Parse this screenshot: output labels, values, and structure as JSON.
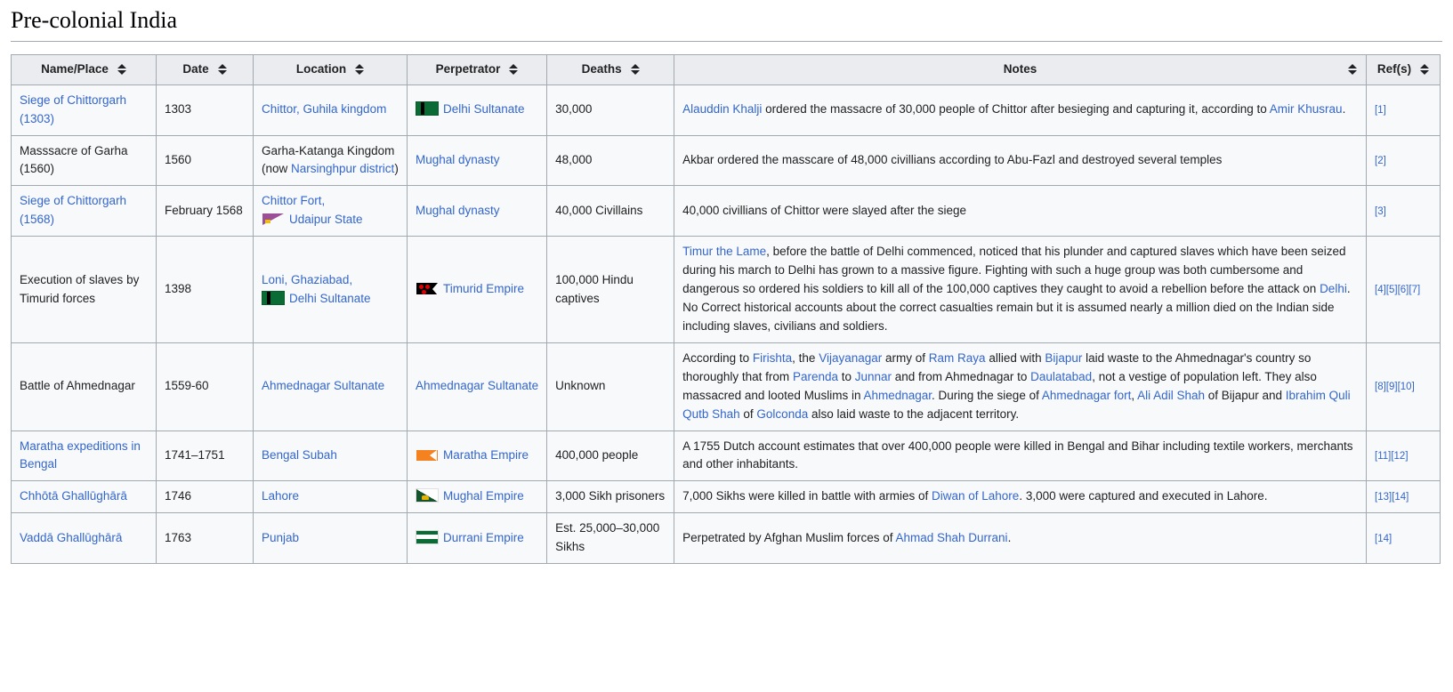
{
  "page": {
    "section_title": "Pre-colonial India"
  },
  "table": {
    "columns": [
      {
        "label": "Name/Place",
        "sortable": true
      },
      {
        "label": "Date",
        "sortable": true
      },
      {
        "label": "Location",
        "sortable": true
      },
      {
        "label": "Perpetrator",
        "sortable": true
      },
      {
        "label": "Deaths",
        "sortable": true
      },
      {
        "label": "Notes",
        "sortable": true
      },
      {
        "label": "Ref(s)",
        "sortable": true
      }
    ],
    "sort_icon": "sort-arrows-icon",
    "rows": [
      {
        "name": {
          "text": "Siege of Chittorgarh (1303)",
          "link": true
        },
        "date": {
          "text": "1303",
          "link": false
        },
        "location": {
          "prefix": "",
          "flag": null,
          "text": "Chittor, Guhila kingdom",
          "link": true
        },
        "perpetrator": {
          "flag": "delhi-sultanate-flag",
          "text": "Delhi Sultanate",
          "link": true
        },
        "deaths": "30,000",
        "notes": [
          {
            "t": "Alauddin Khalji",
            "link": true
          },
          {
            "t": " ordered the massacre of 30,000 people of Chittor after besieging and capturing it, according to ",
            "link": false
          },
          {
            "t": "Amir Khusrau",
            "link": true
          },
          {
            "t": ".",
            "link": false
          }
        ],
        "refs": [
          "[1]"
        ]
      },
      {
        "name": {
          "text": "Masssacre of Garha (1560)",
          "link": false
        },
        "date": {
          "text": "1560",
          "link": false
        },
        "location_parts": [
          {
            "t": "Garha-Katanga Kingdom (now ",
            "link": false
          },
          {
            "t": "Narsinghpur district",
            "link": true
          },
          {
            "t": ")",
            "link": false
          }
        ],
        "perpetrator": {
          "flag": null,
          "text": "Mughal dynasty",
          "link": true
        },
        "deaths": "48,000",
        "notes": [
          {
            "t": "Akbar ordered the masscare of 48,000 civillians according to Abu-Fazl and destroyed several temples",
            "link": false
          }
        ],
        "refs": [
          "[2]"
        ]
      },
      {
        "name": {
          "text": "Siege of Chittorgarh (1568)",
          "link": true
        },
        "date": {
          "text": "February 1568",
          "link": false
        },
        "location_lines": [
          {
            "flag": null,
            "t": "Chittor Fort,",
            "link": true
          },
          {
            "flag": "udaipur-state-flag",
            "t": "Udaipur State",
            "link": true
          }
        ],
        "perpetrator": {
          "flag": null,
          "text": "Mughal dynasty",
          "link": true
        },
        "deaths": "40,000 Civillains",
        "notes": [
          {
            "t": "40,000 civillians of Chittor were slayed after the siege",
            "link": false
          }
        ],
        "refs": [
          "[3]"
        ]
      },
      {
        "name": {
          "text": "Execution of slaves by Timurid forces",
          "link": false
        },
        "date": {
          "text": "1398",
          "link": false
        },
        "location_lines": [
          {
            "flag": null,
            "t": "Loni, Ghaziabad,",
            "link": true
          },
          {
            "flag": "delhi-sultanate-flag",
            "t": "Delhi Sultanate",
            "link": true
          }
        ],
        "perpetrator": {
          "flag": "timurid-empire-flag",
          "text": "Timurid Empire",
          "link": true
        },
        "deaths": "100,000 Hindu captives",
        "notes": [
          {
            "t": "Timur the Lame",
            "link": true
          },
          {
            "t": ", before the battle of Delhi commenced, noticed that his plunder and captured slaves which have been seized during his march to Delhi has grown to a massive figure. Fighting with such a huge group was both cumbersome and dangerous so ordered his soldiers to kill all of the 100,000 captives they caught to avoid a rebellion before the attack on ",
            "link": false
          },
          {
            "t": "Delhi",
            "link": true
          },
          {
            "t": ". No Correct historical accounts about the correct casualties remain but it is assumed nearly a million died on the Indian side including slaves, civilians and soldiers.",
            "link": false
          }
        ],
        "refs": [
          "[4]",
          "[5]",
          "[6]",
          "[7]"
        ]
      },
      {
        "name": {
          "text": "Battle of Ahmednagar",
          "link": false
        },
        "date": {
          "text": "1559-60",
          "link": false
        },
        "location": {
          "flag": null,
          "text": "Ahmednagar Sultanate",
          "link": true
        },
        "perpetrator": {
          "flag": null,
          "text": "Ahmednagar Sultanate",
          "link": true
        },
        "deaths": "Unknown",
        "notes": [
          {
            "t": "According to ",
            "link": false
          },
          {
            "t": "Firishta",
            "link": true
          },
          {
            "t": ", the ",
            "link": false
          },
          {
            "t": "Vijayanagar",
            "link": true
          },
          {
            "t": " army of ",
            "link": false
          },
          {
            "t": "Ram Raya",
            "link": true
          },
          {
            "t": " allied with ",
            "link": false
          },
          {
            "t": "Bijapur",
            "link": true
          },
          {
            "t": " laid waste to the Ahmednagar's country so thoroughly that from ",
            "link": false
          },
          {
            "t": "Parenda",
            "link": true
          },
          {
            "t": " to ",
            "link": false
          },
          {
            "t": "Junnar",
            "link": true
          },
          {
            "t": " and from Ahmednagar to ",
            "link": false
          },
          {
            "t": "Daulatabad",
            "link": true
          },
          {
            "t": ", not a vestige of population left. They also massacred and looted Muslims in ",
            "link": false
          },
          {
            "t": "Ahmednagar",
            "link": true
          },
          {
            "t": ". During the siege of ",
            "link": false
          },
          {
            "t": "Ahmednagar fort",
            "link": true
          },
          {
            "t": ", ",
            "link": false
          },
          {
            "t": "Ali Adil Shah",
            "link": true
          },
          {
            "t": " of Bijapur and ",
            "link": false
          },
          {
            "t": "Ibrahim Quli Qutb Shah",
            "link": true
          },
          {
            "t": " of ",
            "link": false
          },
          {
            "t": "Golconda",
            "link": true
          },
          {
            "t": " also laid waste to the adjacent territory.",
            "link": false
          }
        ],
        "refs": [
          "[8]",
          "[9]",
          "[10]"
        ]
      },
      {
        "name": {
          "text": "Maratha expeditions in Bengal",
          "link": true
        },
        "date": {
          "text": "1741–1751",
          "link": false
        },
        "location": {
          "flag": null,
          "text": "Bengal Subah",
          "link": true
        },
        "perpetrator": {
          "flag": "maratha-empire-flag",
          "text": "Maratha Empire",
          "link": true
        },
        "deaths": "400,000 people",
        "notes": [
          {
            "t": "A 1755 Dutch account estimates that over 400,000 people were killed in Bengal and Bihar including textile workers, merchants and other inhabitants.",
            "link": false
          }
        ],
        "refs": [
          "[11]",
          "[12]"
        ]
      },
      {
        "name": {
          "text": "Chhōtā Ghallūghārā",
          "link": true
        },
        "date": {
          "text": "1746",
          "link": false
        },
        "location": {
          "flag": null,
          "text": "Lahore",
          "link": true
        },
        "perpetrator": {
          "flag": "mughal-empire-flag",
          "text": "Mughal Empire",
          "link": true
        },
        "deaths": "3,000 Sikh prisoners",
        "notes": [
          {
            "t": "7,000 Sikhs were killed in battle with armies of ",
            "link": false
          },
          {
            "t": "Diwan of Lahore",
            "link": true
          },
          {
            "t": ". 3,000 were captured and executed in Lahore.",
            "link": false
          }
        ],
        "refs": [
          "[13]",
          "[14]"
        ]
      },
      {
        "name": {
          "text": "Vaddā Ghallūghārā",
          "link": true
        },
        "date": {
          "text": "1763",
          "link": false
        },
        "location": {
          "flag": null,
          "text": "Punjab",
          "link": true
        },
        "perpetrator": {
          "flag": "durrani-empire-flag",
          "text": "Durrani Empire",
          "link": true
        },
        "deaths": "Est. 25,000–30,000 Sikhs",
        "notes": [
          {
            "t": "Perpetrated by Afghan Muslim forces of ",
            "link": false
          },
          {
            "t": "Ahmad Shah Durrani",
            "link": true
          },
          {
            "t": ".",
            "link": false
          }
        ],
        "refs": [
          "[14]"
        ]
      }
    ]
  },
  "colors": {
    "link": "#3366cc",
    "header_bg": "#eaecf0",
    "cell_bg": "#f8f9fa",
    "border": "#a2a9b1",
    "flag_green": "#0b6b35",
    "flag_saffron": "#f58220",
    "flag_purple": "#9b4f96",
    "flag_red": "#e00000",
    "flag_gold": "#e8b400"
  }
}
